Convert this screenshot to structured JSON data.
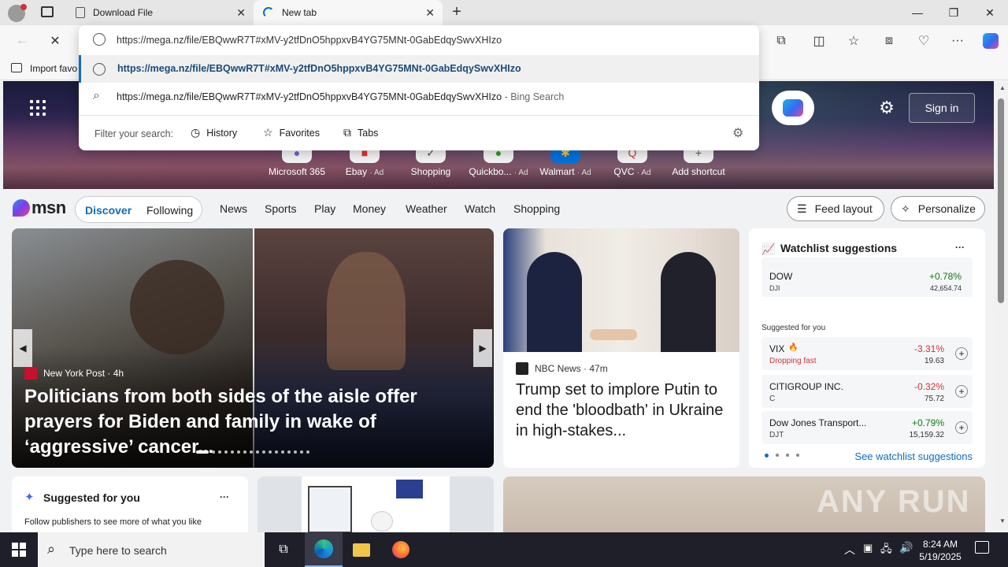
{
  "browser": {
    "tabs": [
      {
        "title": "Download File",
        "active": false
      },
      {
        "title": "New tab",
        "active": true
      }
    ],
    "address_value": "https://mega.nz/file/EBQwwR7T#xMV-y2tfDnO5hppxvB4YG75MNt-0GabEdqySwvXHIzo",
    "favorites_bar_label": "Import favo"
  },
  "omnibox": {
    "suggestion_url": "https://mega.nz/file/EBQwwR7T#xMV-y2tfDnO5hppxvB4YG75MNt-0GabEdqySwvXHIzo",
    "search_query": "https://mega.nz/file/EBQwwR7T#xMV-y2tfDnO5hppxvB4YG75MNt-0GabEdqySwvXHIzo",
    "search_suffix": "- Bing Search",
    "filter_label": "Filter your search:",
    "filters": [
      "History",
      "Favorites",
      "Tabs"
    ]
  },
  "hero": {
    "shortcuts": [
      {
        "label": "Microsoft 365",
        "ad": ""
      },
      {
        "label": "Ebay",
        "ad": "· Ad"
      },
      {
        "label": "Shopping",
        "ad": ""
      },
      {
        "label": "Quickbo...",
        "ad": "· Ad"
      },
      {
        "label": "Walmart",
        "ad": "· Ad"
      },
      {
        "label": "QVC",
        "ad": "· Ad"
      },
      {
        "label": "Add shortcut",
        "ad": ""
      }
    ],
    "sign_in": "Sign in"
  },
  "msn": {
    "logo": "msn",
    "tabs": [
      "Discover",
      "Following"
    ],
    "nav": [
      "News",
      "Sports",
      "Play",
      "Money",
      "Weather",
      "Watch",
      "Shopping"
    ],
    "feed_layout": "Feed layout",
    "personalize": "Personalize"
  },
  "lead_story": {
    "source": "New York Post",
    "age": "· 4h",
    "headline": "Politicians from both sides of the aisle offer prayers for Biden and family in wake of ‘aggressive’ cancer..."
  },
  "second_story": {
    "source": "NBC News",
    "age": "· 47m",
    "headline": "Trump set to implore Putin to end the 'bloodbath' in Ukraine in high-stakes..."
  },
  "watchlist": {
    "title": "Watchlist suggestions",
    "more": "···",
    "top": {
      "name": "DOW",
      "ticker": "DJI",
      "change": "+0.78%",
      "price": "42,654.74"
    },
    "suggested_label": "Suggested for you",
    "items": [
      {
        "name": "VIX",
        "note": "Dropping fast",
        "change": "-3.31%",
        "price": "19.63",
        "dir": "down"
      },
      {
        "name": "CITIGROUP INC.",
        "ticker": "C",
        "change": "-0.32%",
        "price": "75.72",
        "dir": "down"
      },
      {
        "name": "Dow Jones Transport...",
        "ticker": "DJT",
        "change": "+0.79%",
        "price": "15,159.32",
        "dir": "up"
      }
    ],
    "see_more": "See watchlist suggestions"
  },
  "suggested_card": {
    "title": "Suggested for you",
    "more": "···",
    "body": "Follow publishers to see more of what you like"
  },
  "taskbar": {
    "search_placeholder": "Type here to search",
    "time": "8:24 AM",
    "date": "5/19/2025"
  },
  "watermark": "ANY RUN",
  "colors": {
    "accent": "#0f6cbd",
    "up": "#107c10",
    "down": "#d13438"
  }
}
